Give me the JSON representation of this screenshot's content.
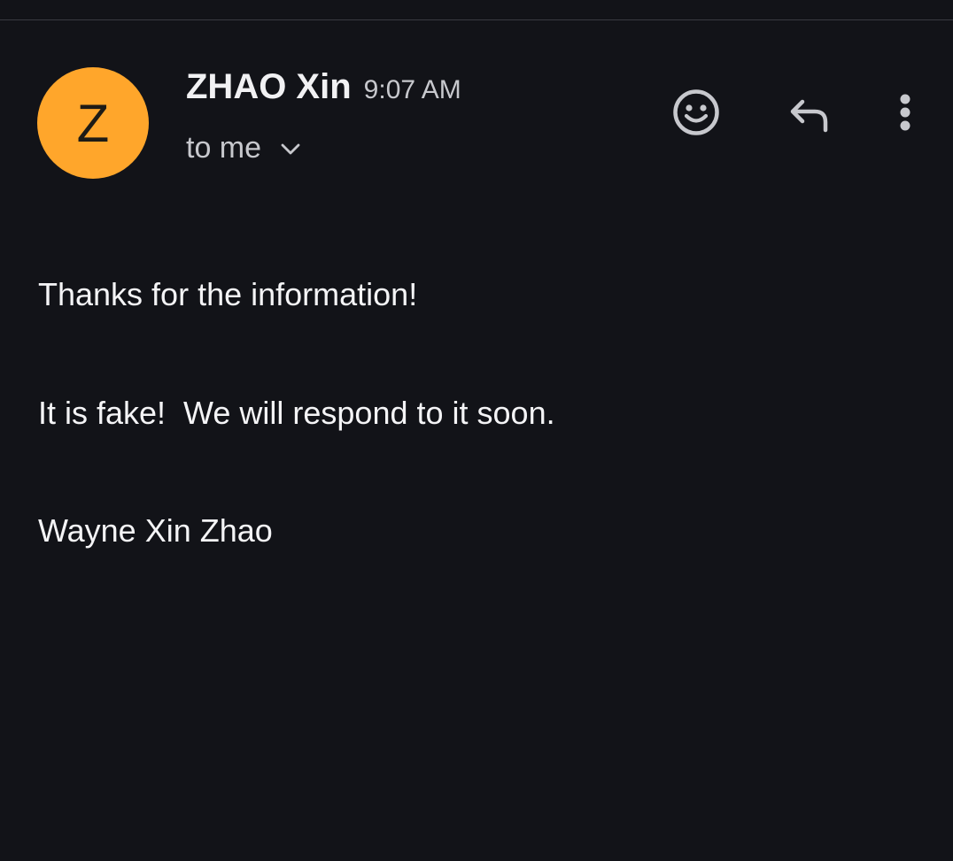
{
  "email": {
    "avatar_initial": "Z",
    "sender_name": "ZHAO Xin",
    "time": "9:07 AM",
    "recipient_label": "to me",
    "body": [
      "Thanks for the information!",
      "It is fake!  We will respond to it soon.",
      "Wayne Xin Zhao"
    ]
  },
  "icons": {
    "emoji": "smiley-face-icon",
    "reply": "reply-arrow-icon",
    "more": "vertical-dots-icon",
    "expand": "chevron-down-icon"
  },
  "colors": {
    "background": "#121318",
    "avatar": "#ffa62b",
    "text_primary": "#f1f1f3",
    "text_secondary": "#c7c8cd"
  }
}
